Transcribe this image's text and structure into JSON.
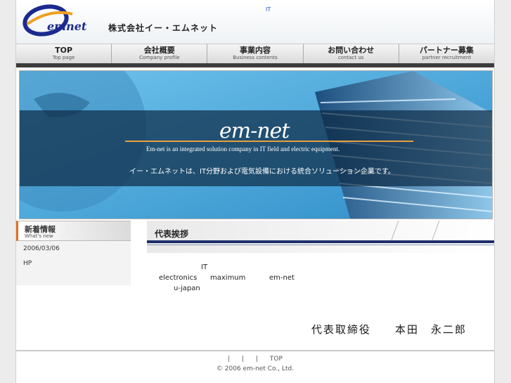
{
  "header": {
    "logo_text": "emnet",
    "company_name": "株式会社イー・エムネット",
    "top_tag": "IT"
  },
  "nav": [
    {
      "label": "TOP",
      "sub": "Top page"
    },
    {
      "label": "会社概要",
      "sub": "Company profile"
    },
    {
      "label": "事業内容",
      "sub": "Business contents"
    },
    {
      "label": "お問い合わせ",
      "sub": "contact us"
    },
    {
      "label": "パートナー募集",
      "sub": "partner recruitment"
    }
  ],
  "banner": {
    "title": "em-net",
    "description": "Em-net is an integrated solution company in IT field and electric equipment.",
    "tagline_jp": "イー・エムネットは、IT分野および電気設備における統合ソリューション企業です。"
  },
  "news": {
    "title": "新着情報",
    "subtitle": "What's new",
    "items": [
      {
        "date": "2006/03/06",
        "text": "HP"
      }
    ]
  },
  "greeting": {
    "title": "代表挨拶",
    "words": [
      "IT",
      "electronics",
      "maximum",
      "em-net",
      "u-japan"
    ],
    "signature": "代表取締役　　本田　永二郎"
  },
  "footer": {
    "links": [
      "|",
      "|",
      "|",
      "TOP"
    ],
    "copyright": "© 2006 em-net Co., Ltd."
  },
  "colors": {
    "accent_orange": "#e07020",
    "navy": "#1f2f6b",
    "sky": "#57b3e2"
  }
}
